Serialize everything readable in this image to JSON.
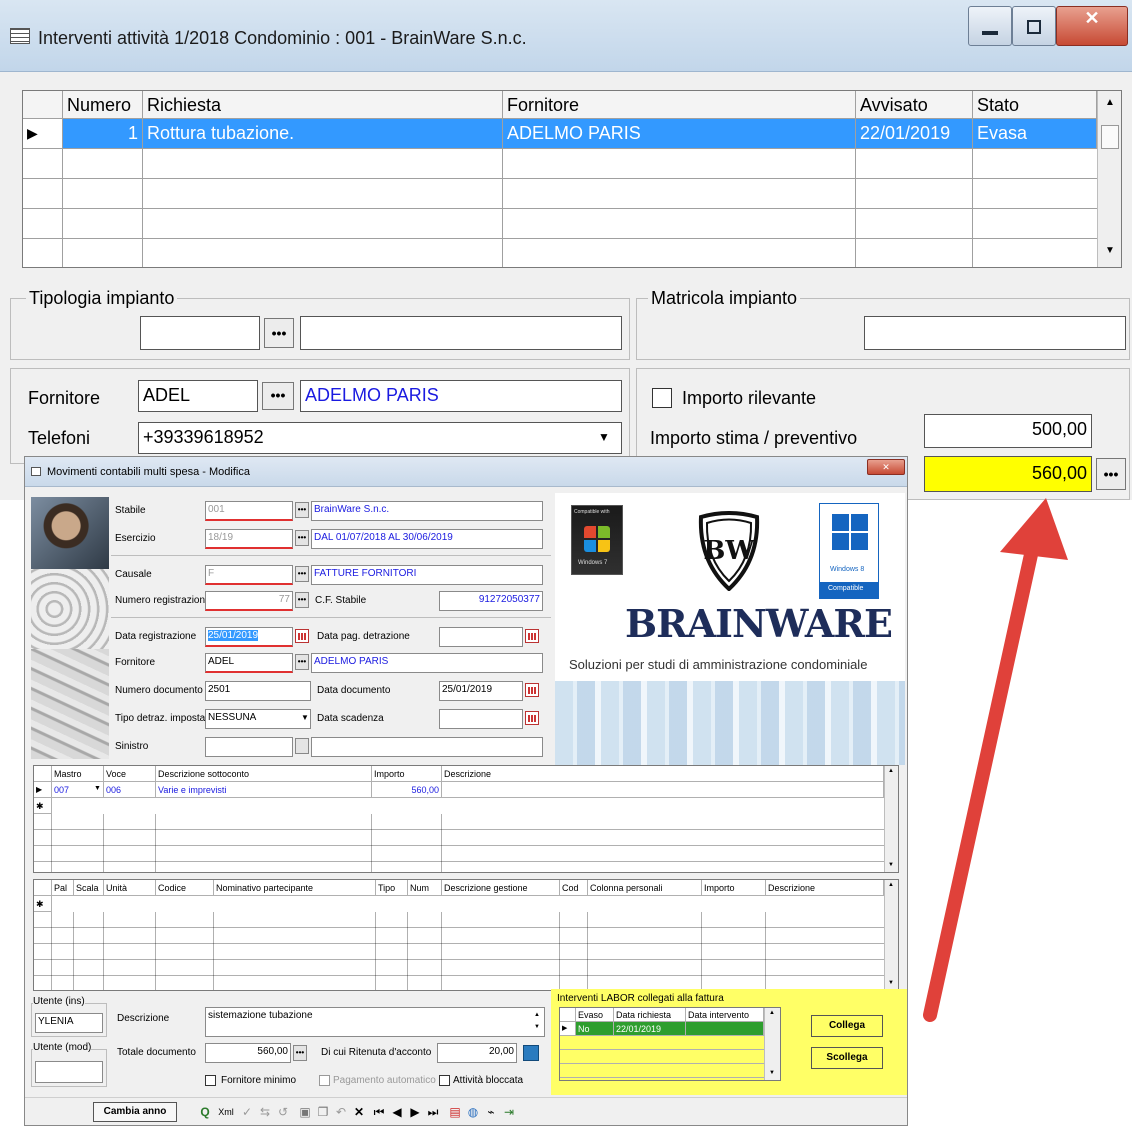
{
  "main": {
    "title": "Interventi attività 1/2018 Condominio : 001 - BrainWare S.n.c.",
    "grid": {
      "headers": [
        "Numero",
        "Richiesta",
        "Fornitore",
        "Avvisato",
        "Stato"
      ],
      "rows": [
        {
          "numero": "1",
          "richiesta": "Rottura tubazione.",
          "fornitore": "ADELMO PARIS",
          "avvisato": "22/01/2019",
          "stato": "Evasa"
        }
      ]
    },
    "tipologia_label": "Tipologia impianto",
    "matricola_label": "Matricola impianto",
    "fornitore_label": "Fornitore",
    "fornitore_code": "ADEL",
    "fornitore_name": "ADELMO PARIS",
    "telefoni_label": "Telefoni",
    "telefoni_value": "+39339618952",
    "importo_rilevante": "Importo rilevante",
    "importo_stima_label": "Importo stima / preventivo",
    "importo_stima": "500,00",
    "importo_finale": "560,00"
  },
  "sub": {
    "title": "Movimenti contabili multi spesa - Modifica",
    "stabile_label": "Stabile",
    "stabile_code": "001",
    "stabile_name": "BrainWare S.n.c.",
    "esercizio_label": "Esercizio",
    "esercizio_code": "18/19",
    "esercizio_desc": "DAL 01/07/2018 AL 30/06/2019",
    "causale_label": "Causale",
    "causale_code": "F",
    "causale_desc": "FATTURE FORNITORI",
    "numreg_label": "Numero registrazione",
    "numreg_value": "77",
    "cf_label": "C.F. Stabile",
    "cf_value": "91272050377",
    "datareg_label": "Data registrazione",
    "datareg_value": "25/01/2019",
    "datapag_label": "Data pag. detrazione",
    "fornitore_label": "Fornitore",
    "fornitore_code": "ADEL",
    "fornitore_name": "ADELMO PARIS",
    "numdoc_label": "Numero documento",
    "numdoc_value": "2501",
    "datadoc_label": "Data documento",
    "datadoc_value": "25/01/2019",
    "tipodetr_label": "Tipo detraz. imposta",
    "tipodetr_value": "NESSUNA",
    "datascad_label": "Data scadenza",
    "sinistro_label": "Sinistro",
    "banner": {
      "compat_label": "Compatible with",
      "win7": "Windows 7",
      "win8": "Windows 8",
      "win8_compat": "Compatible",
      "brand": "BRAINWARE",
      "tagline": "Soluzioni per studi di amministrazione condominiale"
    },
    "grid1": {
      "headers": [
        "Mastro",
        "Voce",
        "Descrizione sottoconto",
        "Importo",
        "Descrizione"
      ],
      "row": {
        "mastro": "007",
        "voce": "006",
        "desc": "Varie e imprevisti",
        "importo": "560,00"
      }
    },
    "grid2": {
      "headers": [
        "Pal",
        "Scala",
        "Unità",
        "Codice",
        "Nominativo partecipante",
        "Tipo",
        "Num",
        "Descrizione gestione",
        "Cod",
        "Colonna personali",
        "Importo",
        "Descrizione"
      ]
    },
    "utente_ins_label": "Utente (ins)",
    "utente_ins_value": "YLENIA",
    "utente_mod_label": "Utente (mod)",
    "descrizione_label": "Descrizione",
    "descrizione_value": "sistemazione tubazione",
    "totale_label": "Totale documento",
    "totale_value": "560,00",
    "ritenuta_label": "Di cui Ritenuta d'acconto",
    "ritenuta_value": "20,00",
    "fornitore_minimo": "Fornitore minimo",
    "pagamento_automatico": "Pagamento automatico",
    "attivita_bloccata": "Attività bloccata",
    "labor": {
      "label": "Interventi LABOR collegati alla fattura",
      "headers": [
        "Evaso",
        "Data richiesta",
        "Data intervento"
      ],
      "row": {
        "evaso": "No",
        "data_richiesta": "22/01/2019",
        "data_intervento": ""
      },
      "collega": "Collega",
      "scollega": "Scollega"
    },
    "cambia_anno": "Cambia anno",
    "xml_label": "Xml"
  },
  "colors": {
    "selection": "#3399ff",
    "highlight": "#ffff00",
    "labor_bg": "#ffff66",
    "labor_row": "#2e9e2e",
    "arrow": "#e0413a"
  }
}
